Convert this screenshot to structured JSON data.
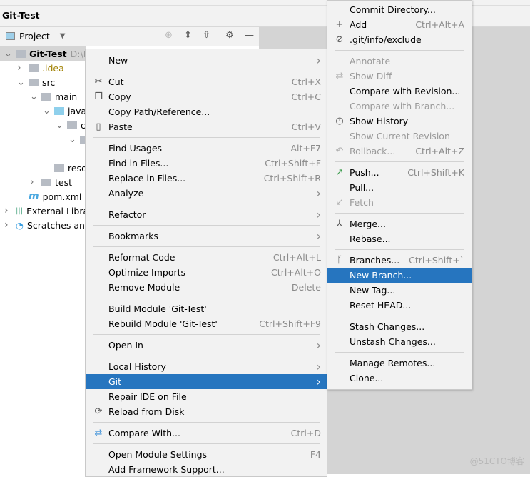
{
  "window": {
    "title": "Git-Test"
  },
  "toolbar": {
    "project_label": "Project"
  },
  "tree": [
    {
      "label": "Git-Test",
      "suffix": "D:\\ID",
      "depth": 0,
      "expanded": true,
      "selected": true,
      "bold": true
    },
    {
      "label": ".idea",
      "depth": 1,
      "expanded": false,
      "color": "#a08000"
    },
    {
      "label": "src",
      "depth": 1,
      "expanded": true
    },
    {
      "label": "main",
      "depth": 2,
      "expanded": true
    },
    {
      "label": "java",
      "depth": 3,
      "expanded": true,
      "blue": true
    },
    {
      "label": "c",
      "depth": 4,
      "expanded": true
    },
    {
      "label": "",
      "depth": 5,
      "expanded": true
    },
    {
      "label": "",
      "depth": 6,
      "leaf": true
    },
    {
      "label": "reso",
      "depth": 3,
      "leaf": true
    },
    {
      "label": "test",
      "depth": 2,
      "expanded": false
    },
    {
      "label": "pom.xml",
      "depth": 1,
      "leaf": true,
      "maven": true
    },
    {
      "label": "External Libra",
      "depth": 0,
      "expanded": false,
      "lib": true
    },
    {
      "label": "Scratches and",
      "depth": 0,
      "expanded": false,
      "scratch": true
    }
  ],
  "context_menu": [
    {
      "label": "New",
      "submenu": true
    },
    {
      "sep": true
    },
    {
      "label": "Cut",
      "shortcut": "Ctrl+X",
      "icon": "scissors-icon",
      "glyph": "✂"
    },
    {
      "label": "Copy",
      "shortcut": "Ctrl+C",
      "icon": "copy-icon",
      "glyph": "❐"
    },
    {
      "label": "Copy Path/Reference..."
    },
    {
      "label": "Paste",
      "shortcut": "Ctrl+V",
      "icon": "paste-icon",
      "glyph": "▯"
    },
    {
      "sep": true
    },
    {
      "label": "Find Usages",
      "shortcut": "Alt+F7"
    },
    {
      "label": "Find in Files...",
      "shortcut": "Ctrl+Shift+F"
    },
    {
      "label": "Replace in Files...",
      "shortcut": "Ctrl+Shift+R"
    },
    {
      "label": "Analyze",
      "submenu": true
    },
    {
      "sep": true
    },
    {
      "label": "Refactor",
      "submenu": true
    },
    {
      "sep": true
    },
    {
      "label": "Bookmarks",
      "submenu": true
    },
    {
      "sep": true
    },
    {
      "label": "Reformat Code",
      "shortcut": "Ctrl+Alt+L"
    },
    {
      "label": "Optimize Imports",
      "shortcut": "Ctrl+Alt+O"
    },
    {
      "label": "Remove Module",
      "shortcut": "Delete"
    },
    {
      "sep": true
    },
    {
      "label": "Build Module 'Git-Test'"
    },
    {
      "label": "Rebuild Module 'Git-Test'",
      "shortcut": "Ctrl+Shift+F9"
    },
    {
      "sep": true
    },
    {
      "label": "Open In",
      "submenu": true
    },
    {
      "sep": true
    },
    {
      "label": "Local History",
      "submenu": true
    },
    {
      "label": "Git",
      "submenu": true,
      "highlighted": true
    },
    {
      "label": "Repair IDE on File"
    },
    {
      "label": "Reload from Disk",
      "icon": "reload-icon",
      "glyph": "⟳"
    },
    {
      "sep": true
    },
    {
      "label": "Compare With...",
      "shortcut": "Ctrl+D",
      "icon": "compare-icon",
      "glyph": "⇄",
      "glyph_color": "#3a8fd8"
    },
    {
      "sep": true
    },
    {
      "label": "Open Module Settings",
      "shortcut": "F4"
    },
    {
      "label": "Add Framework Support..."
    }
  ],
  "git_submenu": [
    {
      "label": "Commit Directory..."
    },
    {
      "label": "Add",
      "shortcut": "Ctrl+Alt+A",
      "icon": "plus-icon",
      "glyph": "+"
    },
    {
      "label": ".git/info/exclude",
      "icon": "exclude-file-icon",
      "glyph": "⊘"
    },
    {
      "sep": true
    },
    {
      "label": "Annotate",
      "disabled": true
    },
    {
      "label": "Show Diff",
      "disabled": true,
      "icon": "diff-icon",
      "glyph": "⇄"
    },
    {
      "label": "Compare with Revision..."
    },
    {
      "label": "Compare with Branch...",
      "disabled": true
    },
    {
      "label": "Show History",
      "icon": "clock-icon",
      "glyph": "◷"
    },
    {
      "label": "Show Current Revision",
      "disabled": true
    },
    {
      "label": "Rollback...",
      "shortcut": "Ctrl+Alt+Z",
      "disabled": true,
      "icon": "rollback-icon",
      "glyph": "↶"
    },
    {
      "sep": true
    },
    {
      "label": "Push...",
      "shortcut": "Ctrl+Shift+K",
      "icon": "push-arrow-icon",
      "glyph": "↗",
      "glyph_color": "#3b9c4c"
    },
    {
      "label": "Pull..."
    },
    {
      "label": "Fetch",
      "disabled": true,
      "icon": "fetch-icon",
      "glyph": "↙"
    },
    {
      "sep": true
    },
    {
      "label": "Merge...",
      "icon": "merge-icon",
      "glyph": "⅄"
    },
    {
      "label": "Rebase..."
    },
    {
      "sep": true
    },
    {
      "label": "Branches...",
      "shortcut": "Ctrl+Shift+`",
      "icon": "branch-icon",
      "glyph": "ᚴ"
    },
    {
      "label": "New Branch...",
      "highlighted": true
    },
    {
      "label": "New Tag..."
    },
    {
      "label": "Reset HEAD..."
    },
    {
      "sep": true
    },
    {
      "label": "Stash Changes..."
    },
    {
      "label": "Unstash Changes..."
    },
    {
      "sep": true
    },
    {
      "label": "Manage Remotes..."
    },
    {
      "label": "Clone..."
    }
  ],
  "watermark": "@51CTO博客"
}
